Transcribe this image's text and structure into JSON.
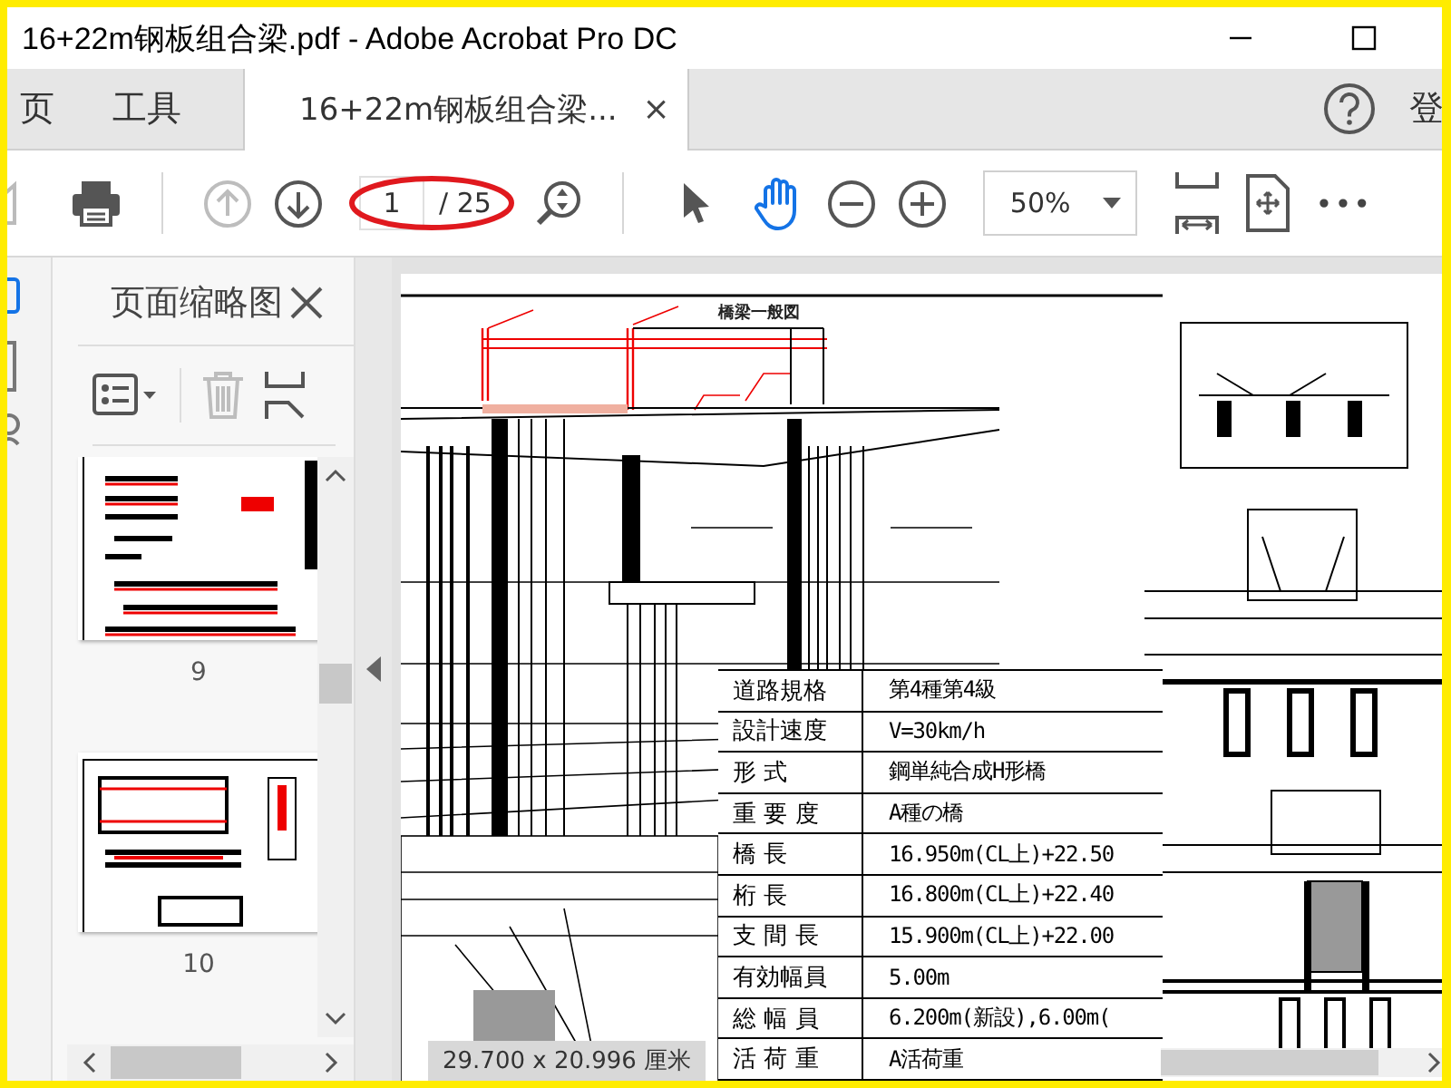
{
  "window": {
    "title": "16+22m钢板组合梁.pdf - Adobe Acrobat Pro DC"
  },
  "tabs": [
    {
      "label": "页",
      "selected": false
    },
    {
      "label": "工具",
      "selected": false
    },
    {
      "label": "16+22m钢板组合梁...",
      "selected": true,
      "close": "×"
    }
  ],
  "account_label": "登",
  "toolbar": {
    "nav_buttons": [
      {
        "kind": "up",
        "disabled": true
      },
      {
        "kind": "down",
        "disabled": false
      }
    ],
    "page_number": "1",
    "page_count": "/ 25",
    "tools": [
      {
        "kind": "select",
        "selected": false
      },
      {
        "kind": "hand",
        "selected": true
      }
    ],
    "zoom": "50%",
    "more": "•••"
  },
  "thumbnail_panel": {
    "title": "页面缩略图",
    "pages": [
      {
        "number": "9"
      },
      {
        "number": "10"
      }
    ]
  },
  "document": {
    "drawing_title": "橋梁一般図",
    "spec_table": {
      "rows": [
        {
          "label": "道路規格",
          "value": "第4種第4級"
        },
        {
          "label": "設計速度",
          "value": "V=30km/h"
        },
        {
          "label": "形 式",
          "value": "鋼単純合成H形橋"
        },
        {
          "label": "重 要 度",
          "value": "A種の橋"
        },
        {
          "label": "橋 長",
          "value": "16.950m(CL上)+22.50"
        },
        {
          "label": "桁 長",
          "value": "16.800m(CL上)+22.40"
        },
        {
          "label": "支 間 長",
          "value": "15.900m(CL上)+22.00"
        },
        {
          "label": "有効幅員",
          "value": "5.00m"
        },
        {
          "label": "総 幅 員",
          "value": "6.200m(新設),6.00m("
        },
        {
          "label": "活 荷 重",
          "value": "A活荷重"
        }
      ]
    },
    "page_size": "29.700 x 20.996 厘米"
  }
}
